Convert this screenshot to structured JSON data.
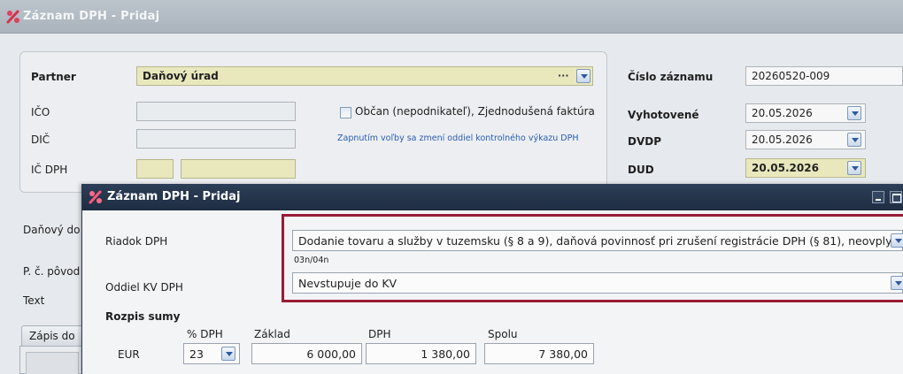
{
  "background_window": {
    "title": "Záznam DPH - Pridaj",
    "partner": {
      "label": "Partner",
      "value": "Daňový úrad",
      "dots": "···"
    },
    "ico": {
      "label": "IČO",
      "value": ""
    },
    "dic": {
      "label": "DIČ",
      "value": ""
    },
    "icdph": {
      "label": "IČ DPH",
      "value1": "",
      "value2": ""
    },
    "obcan_checkbox": {
      "label": "Občan (nepodnikateľ), Zjednodušená faktúra",
      "checked": false
    },
    "note": "Zapnutím voľby sa zmení oddiel kontrolného výkazu DPH",
    "cislo_zaznamu": {
      "label": "Číslo záznamu",
      "value": "20260520-009"
    },
    "vyhotovene": {
      "label": "Vyhotovené",
      "value": "20.05.2026"
    },
    "dvdp": {
      "label": "DVDP",
      "value": "20.05.2026"
    },
    "dud": {
      "label": "DUD",
      "value": "20.05.2026"
    },
    "danovy_doklad_label": "Daňový do",
    "p_c_povodneho_label": "P. č. pôvod",
    "text_label": "Text",
    "tab_label": "Zápis do"
  },
  "dialog": {
    "title": "Záznam DPH - Pridaj",
    "riadok_dph": {
      "label": "Riadok DPH",
      "value": "Dodanie tovaru a služby v tuzemsku (§ 8 a 9), daňová povinnosť pri zrušení registrácie DPH (§ 81), neovplyvňuj",
      "code": "03n/04n"
    },
    "oddiel_kv": {
      "label": "Oddiel KV DPH",
      "value": "Nevstupuje do KV"
    },
    "rozpis": {
      "title": "Rozpis sumy",
      "col_pct": "% DPH",
      "col_zaklad": "Základ",
      "col_dph": "DPH",
      "col_spolu": "Spolu",
      "currency": "EUR",
      "pct": "23",
      "zaklad": "6 000,00",
      "dph": "1 380,00",
      "spolu": "7 380,00"
    }
  },
  "colors": {
    "highlight": "#9b1b35",
    "dialog_title": "#1e2d42",
    "yellow_field": "#e9e8bd"
  }
}
